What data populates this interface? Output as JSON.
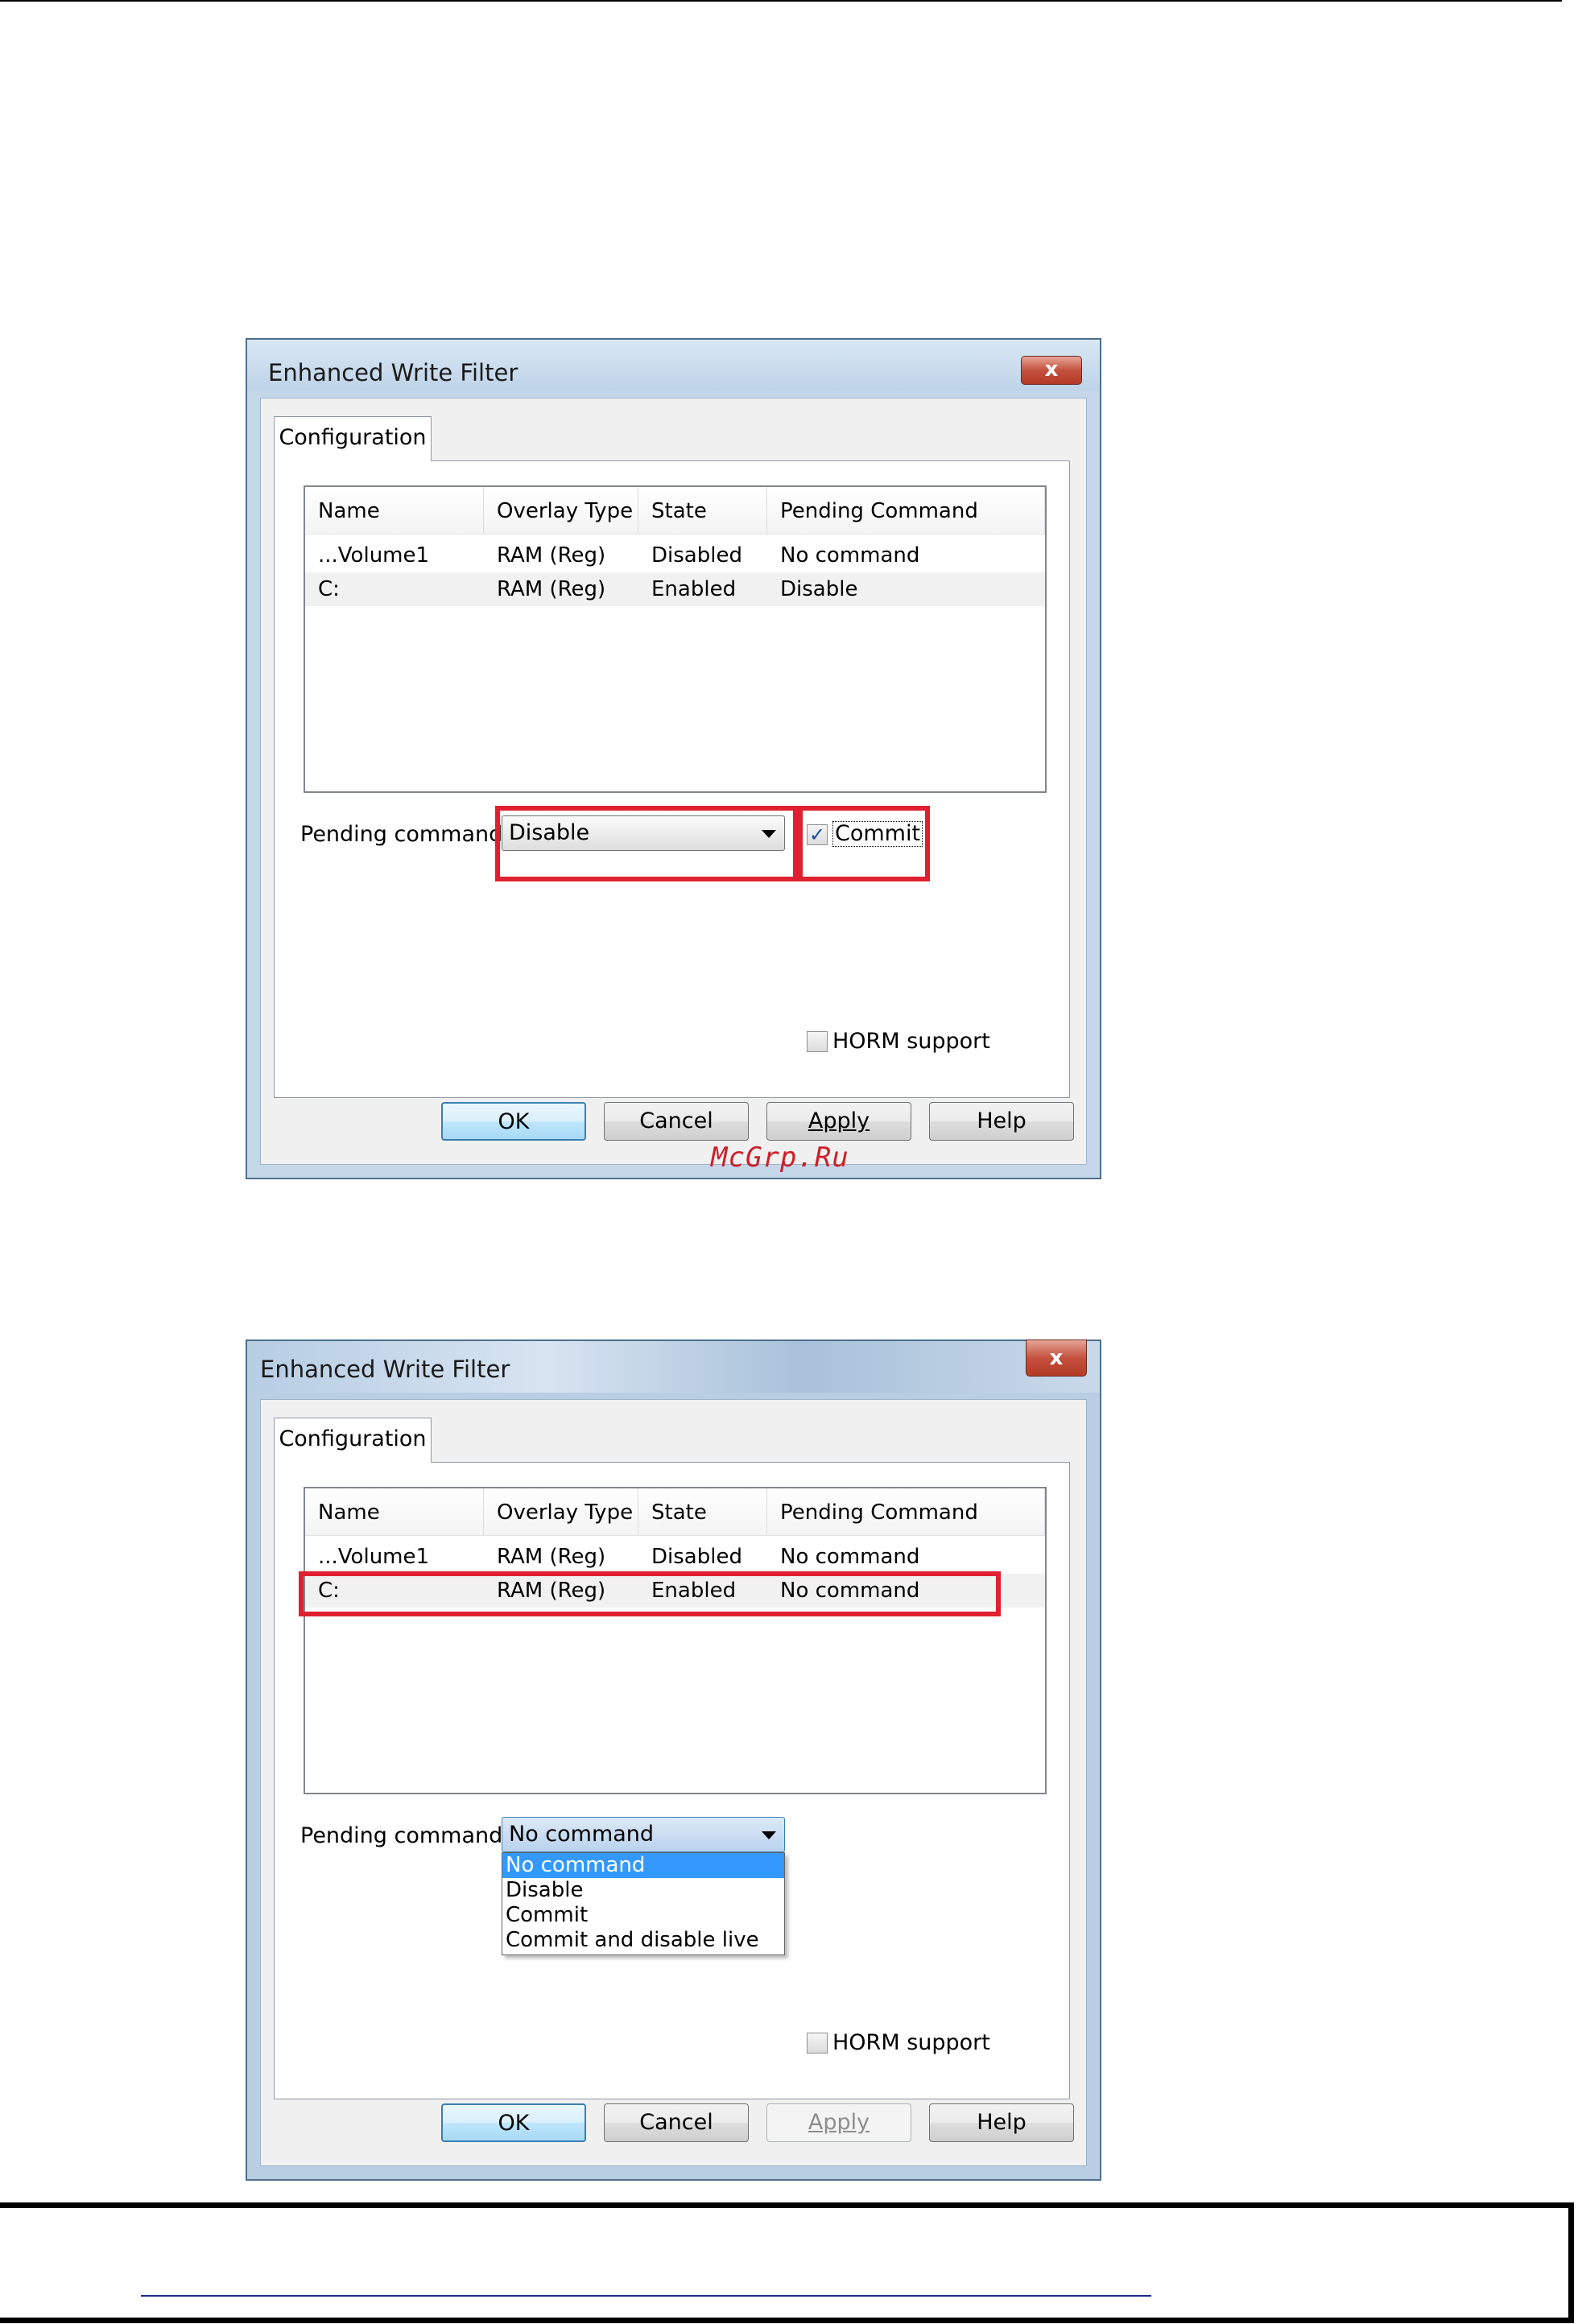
{
  "dialog1": {
    "title": "Enhanced Write Filter",
    "close_symbol": "x",
    "tab": "Configuration",
    "columns": [
      "Name",
      "Overlay Type",
      "State",
      "Pending Command"
    ],
    "rows": [
      {
        "name": "...Volume1",
        "overlay": "RAM (Reg)",
        "state": "Disabled",
        "pending": "No command"
      },
      {
        "name": "C:",
        "overlay": "RAM (Reg)",
        "state": "Enabled",
        "pending": "Disable"
      }
    ],
    "pending_label": "Pending command:",
    "pending_value": "Disable",
    "commit_label": "Commit",
    "commit_checked": true,
    "horm_label": "HORM support",
    "horm_checked": false,
    "buttons": {
      "ok": "OK",
      "cancel": "Cancel",
      "apply": "Apply",
      "help": "Help"
    }
  },
  "watermark": "McGrp.Ru",
  "dialog2": {
    "title": "Enhanced Write Filter",
    "close_symbol": "x",
    "tab": "Configuration",
    "columns": [
      "Name",
      "Overlay Type",
      "State",
      "Pending Command"
    ],
    "rows": [
      {
        "name": "...Volume1",
        "overlay": "RAM (Reg)",
        "state": "Disabled",
        "pending": "No command"
      },
      {
        "name": "C:",
        "overlay": "RAM (Reg)",
        "state": "Enabled",
        "pending": "No command"
      }
    ],
    "pending_label": "Pending command:",
    "pending_value": "No command",
    "dropdown_options": [
      "No command",
      "Disable",
      "Commit",
      "Commit and disable live"
    ],
    "horm_label": "HORM support",
    "horm_checked": false,
    "buttons": {
      "ok": "OK",
      "cancel": "Cancel",
      "apply": "Apply",
      "help": "Help"
    },
    "apply_enabled": false
  },
  "colors": {
    "highlight": "#e02030",
    "selection": "#3399ff",
    "close_button": "#c4513e"
  },
  "icons": {
    "close": "close-icon",
    "dropdown_arrow": "chevron-down-icon",
    "check": "check-icon"
  }
}
